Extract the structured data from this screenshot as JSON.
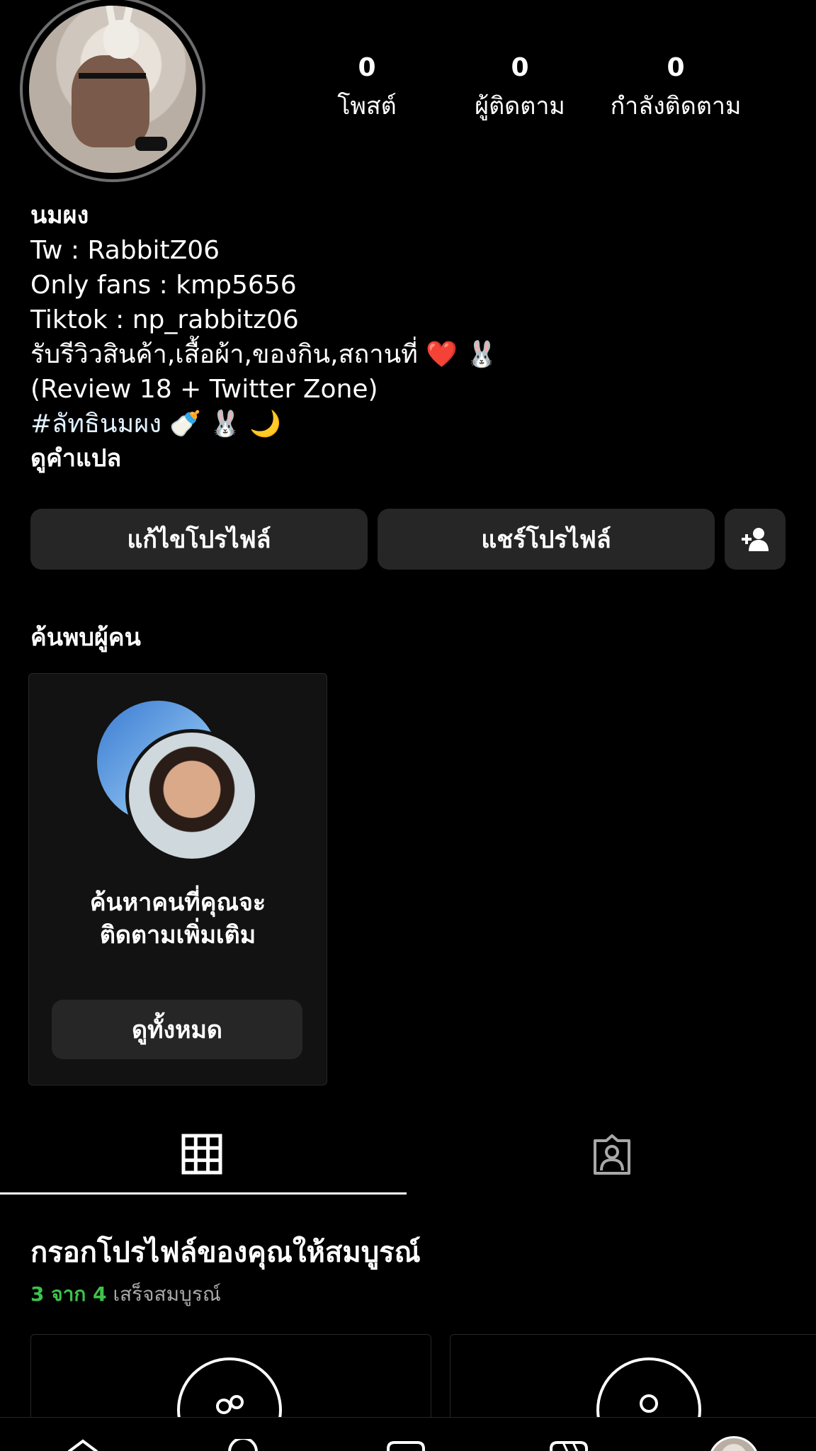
{
  "stats": [
    {
      "count": "0",
      "label": "โพสต์"
    },
    {
      "count": "0",
      "label": "ผู้ติดตาม"
    },
    {
      "count": "0",
      "label": "กำลังติดตาม"
    }
  ],
  "bio": {
    "name": "นมผง",
    "lines": [
      "Tw : RabbitZ06",
      "Only fans : kmp5656",
      "Tiktok : np_rabbitz06",
      "รับรีวิวสินค้า,เสื้อผ้า,ของกิน,สถานที่ ❤️ 🐰",
      "(Review 18 + Twitter Zone)"
    ],
    "hashtag": "#ลัทธินมผง",
    "hashtag_emoji": "🍼 🐰 🌙",
    "translate": "ดูคำแปล"
  },
  "actions": {
    "edit_profile": "แก้ไขโปรไฟล์",
    "share_profile": "แชร์โปรไฟล์"
  },
  "discover": {
    "title": "ค้นพบผู้คน",
    "caption_line1": "ค้นหาคนที่คุณจะ",
    "caption_line2": "ติดตามเพิ่มเติม",
    "see_all": "ดูทั้งหมด"
  },
  "completion": {
    "title": "กรอกโปรไฟล์ของคุณให้สมบูรณ์",
    "progress_count": "3 จาก 4",
    "progress_label": "เสร็จสมบูรณ์",
    "progress_fraction": 0.75
  },
  "icons": {
    "grid": "grid-icon",
    "tagged": "tagged-icon",
    "add_user": "add-person-icon"
  }
}
